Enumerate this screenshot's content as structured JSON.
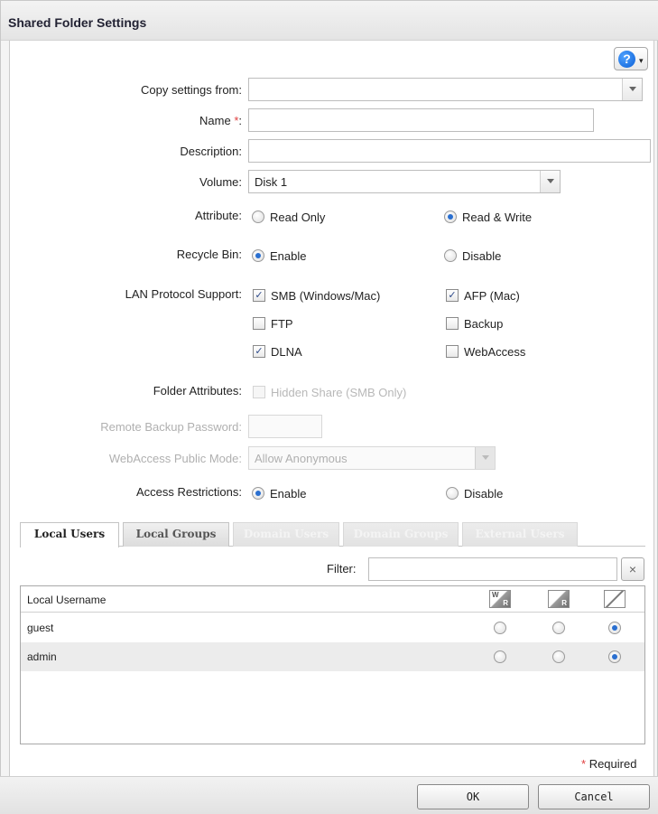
{
  "dialog": {
    "title": "Shared Folder Settings"
  },
  "help": {
    "glyph": "?",
    "dropdown": "▾"
  },
  "form": {
    "copy_settings_label": "Copy settings from:",
    "copy_settings_value": "",
    "name_label": "Name",
    "name_required_mark": "*",
    "name_colon": ":",
    "name_value": "",
    "description_label": "Description:",
    "description_value": "",
    "volume_label": "Volume:",
    "volume_value": "Disk 1",
    "attribute_label": "Attribute:",
    "attribute_options": [
      "Read Only",
      "Read & Write"
    ],
    "attribute_selected": "Read & Write",
    "recycle_bin_label": "Recycle Bin:",
    "recycle_bin_options": [
      "Enable",
      "Disable"
    ],
    "recycle_bin_selected": "Enable",
    "lan_protocol_label": "LAN Protocol Support:",
    "lan_protocols": [
      {
        "label": "SMB (Windows/Mac)",
        "checked": true
      },
      {
        "label": "AFP (Mac)",
        "checked": true
      },
      {
        "label": "FTP",
        "checked": false
      },
      {
        "label": "Backup",
        "checked": false
      },
      {
        "label": "DLNA",
        "checked": true
      },
      {
        "label": "WebAccess",
        "checked": false
      }
    ],
    "folder_attributes_label": "Folder Attributes:",
    "hidden_share_label": "Hidden Share (SMB Only)",
    "remote_backup_password_label": "Remote Backup Password:",
    "webaccess_public_mode_label": "WebAccess Public Mode:",
    "webaccess_public_mode_value": "Allow Anonymous",
    "access_restrictions_label": "Access Restrictions:",
    "access_restrictions_options": [
      "Enable",
      "Disable"
    ],
    "access_restrictions_selected": "Enable"
  },
  "tabs": [
    {
      "label": "Local Users",
      "active": true,
      "enabled": true
    },
    {
      "label": "Local Groups",
      "active": false,
      "enabled": true
    },
    {
      "label": "Domain Users",
      "active": false,
      "enabled": false
    },
    {
      "label": "Domain Groups",
      "active": false,
      "enabled": false
    },
    {
      "label": "External Users",
      "active": false,
      "enabled": false
    }
  ],
  "filter": {
    "label": "Filter:",
    "value": "",
    "clear_glyph": "×"
  },
  "user_table": {
    "column_header": "Local Username",
    "permission_columns": [
      {
        "icon": "read-write-icon",
        "top": "W",
        "bottom": "R"
      },
      {
        "icon": "read-only-icon",
        "top": "",
        "bottom": "R"
      },
      {
        "icon": "no-access-icon",
        "top": "",
        "bottom": ""
      }
    ],
    "rows": [
      {
        "username": "guest",
        "permission": "no-access"
      },
      {
        "username": "admin",
        "permission": "no-access"
      }
    ]
  },
  "footer": {
    "required_mark": "*",
    "required_text": "Required",
    "ok_label": "OK",
    "cancel_label": "Cancel"
  },
  "colors": {
    "required": "#e04040",
    "radio_selected": "#2a6fd0",
    "help_icon": "#0b5fd6"
  }
}
